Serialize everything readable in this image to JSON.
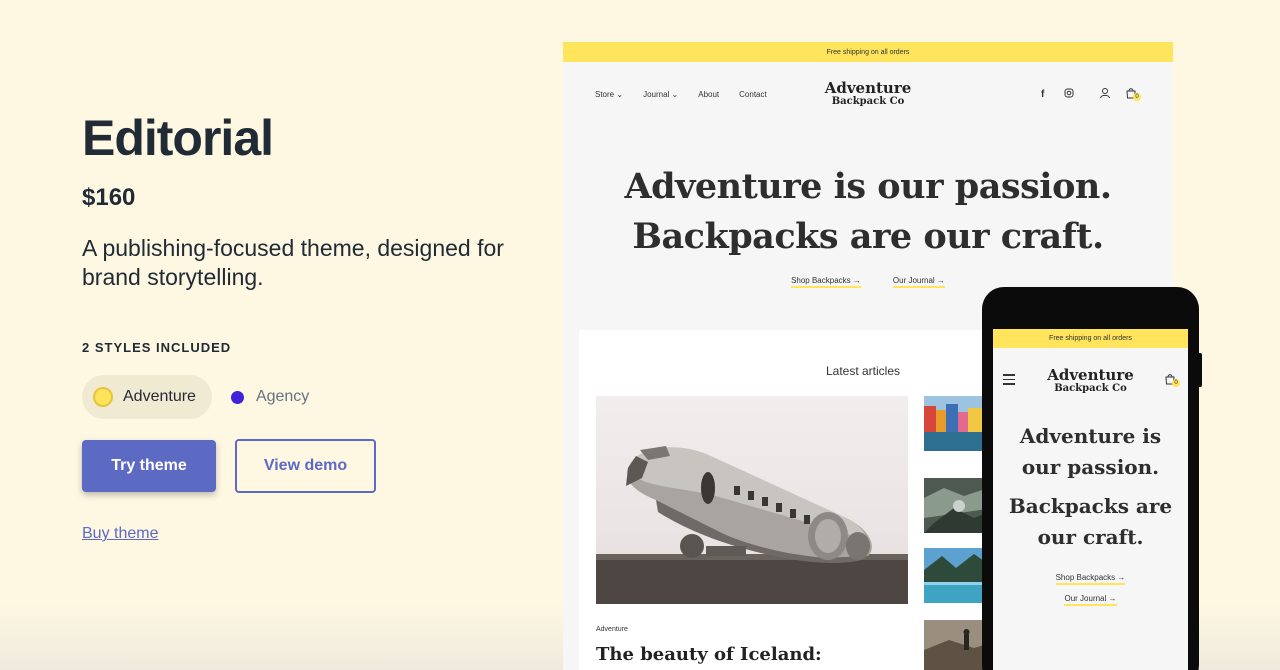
{
  "theme": {
    "name": "Editorial",
    "price": "$160",
    "description": "A publishing-focused theme, designed for brand storytelling.",
    "styles_label": "2 STYLES INCLUDED",
    "styles": [
      {
        "label": "Adventure",
        "color": "#fde35a",
        "selected": true
      },
      {
        "label": "Agency",
        "color": "#4222d8",
        "selected": false
      }
    ],
    "try_label": "Try theme",
    "demo_label": "View demo",
    "buy_label": "Buy theme"
  },
  "colors": {
    "background": "#fef8e3",
    "accent": "#5c6ac4",
    "announcement": "#ffe45c"
  },
  "desktop_preview": {
    "announcement": "Free shipping on all orders",
    "nav": [
      "Store",
      "Journal",
      "About",
      "Contact"
    ],
    "logo_line1": "Adventure",
    "logo_line2": "Backpack Co",
    "hero_line1": "Adventure is our passion.",
    "hero_line2": "Backpacks are our craft.",
    "cta1": "Shop Backpacks",
    "cta2": "Our Journal",
    "cart_count": "0",
    "articles_title": "Latest articles",
    "article_category": "Adventure",
    "article_title": "The beauty of Iceland:"
  },
  "mobile_preview": {
    "announcement": "Free shipping on all orders",
    "logo_line1": "Adventure",
    "logo_line2": "Backpack Co",
    "hero_line1": "Adventure is",
    "hero_line2": "our passion.",
    "hero_line3": "Backpacks are",
    "hero_line4": "our craft.",
    "cta1": "Shop Backpacks",
    "cta2": "Our Journal",
    "cart_count": "0"
  }
}
